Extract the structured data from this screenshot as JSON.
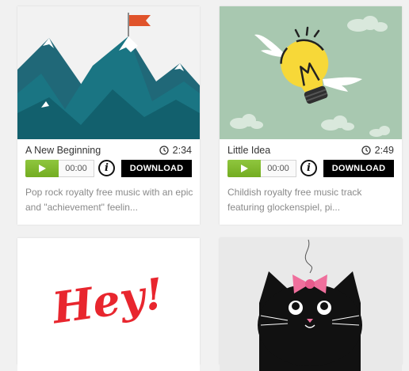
{
  "cards": [
    {
      "title": "A New Beginning",
      "duration": "2:34",
      "time": "00:00",
      "info_label": "i",
      "download_label": "DOWNLOAD",
      "description": "Pop rock royalty free music with an epic and \"achievement\" feelin...",
      "thumbnail": "mountains-with-red-flag",
      "thumb_colors": {
        "bg": "#f2f2f2",
        "mountain": "#1d6f7e",
        "snow": "#ffffff",
        "flag": "#e0532b"
      }
    },
    {
      "title": "Little Idea",
      "duration": "2:49",
      "time": "00:00",
      "info_label": "i",
      "download_label": "DOWNLOAD",
      "description": "Childish royalty free music track featuring glockenspiel, pi...",
      "thumbnail": "flying-light-bulb",
      "thumb_colors": {
        "bg": "#a8c8b0",
        "bulb": "#f7d838",
        "cloud": "#d9e8dc"
      }
    },
    {
      "thumbnail": "hey-lettering",
      "lettering": "Hey!",
      "thumb_colors": {
        "bg": "#ffffff",
        "text": "#e8262e"
      }
    },
    {
      "thumbnail": "black-cat-with-pink-bow",
      "thumb_colors": {
        "bg": "#e9e9e9",
        "cat": "#111111",
        "bow": "#ef6f9c"
      }
    }
  ],
  "icons": {
    "clock": "clock-icon",
    "play": "play-icon",
    "info": "info-icon"
  }
}
